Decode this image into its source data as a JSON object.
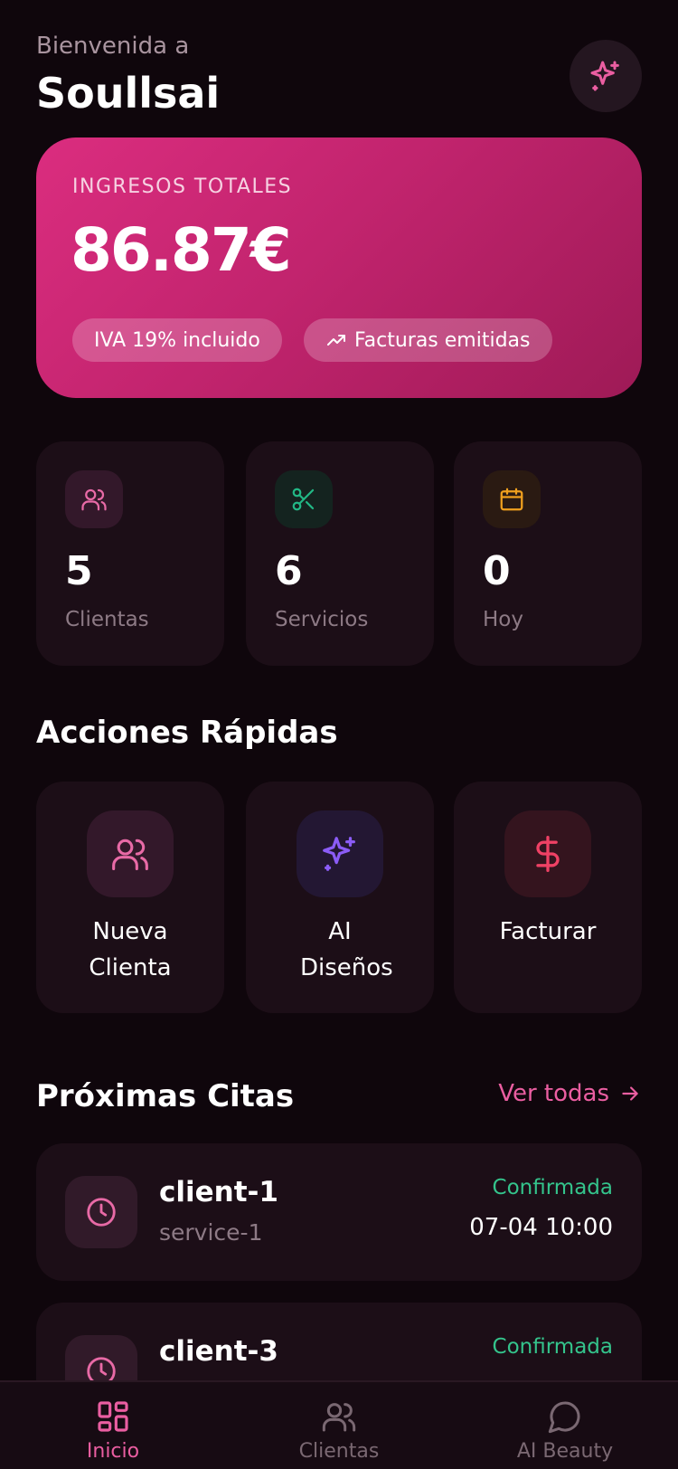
{
  "header": {
    "greeting": "Bienvenida a",
    "brand": "Soullsai"
  },
  "income": {
    "label": "INGRESOS TOTALES",
    "value": "86.87€",
    "pill_vat": "IVA 19% incluido",
    "pill_invoices": "Facturas emitidas"
  },
  "stats": [
    {
      "value": "5",
      "label": "Clientas",
      "icon": "users-icon",
      "color": "#e86aa6"
    },
    {
      "value": "6",
      "label": "Servicios",
      "icon": "scissors-icon",
      "color": "#22b785"
    },
    {
      "value": "0",
      "label": "Hoy",
      "icon": "calendar-icon",
      "color": "#f0a01e"
    }
  ],
  "quick_actions": {
    "title": "Acciones Rápidas",
    "items": [
      {
        "label": "Nueva Clienta",
        "icon": "users-icon",
        "color": "#e86aa6"
      },
      {
        "label": "AI Diseños",
        "icon": "sparkles-icon",
        "color": "#8b5cf6"
      },
      {
        "label": "Facturar",
        "icon": "dollar-icon",
        "color": "#ef4165"
      }
    ]
  },
  "appointments": {
    "title": "Próximas Citas",
    "see_all": "Ver todas",
    "items": [
      {
        "client": "client-1",
        "service": "service-1",
        "status": "Confirmada",
        "time": "07-04 10:00"
      },
      {
        "client": "client-3",
        "service": "",
        "status": "Confirmada",
        "time": ""
      }
    ]
  },
  "nav": {
    "items": [
      {
        "label": "Inicio",
        "icon": "grid-icon",
        "active": true
      },
      {
        "label": "Clientas",
        "icon": "users-icon",
        "active": false
      },
      {
        "label": "AI Beauty",
        "icon": "chat-icon",
        "active": false
      }
    ]
  },
  "colors": {
    "accent": "#ea5ea1",
    "background": "#0f060c",
    "card": "#1c0e17",
    "success": "#34c48c"
  }
}
